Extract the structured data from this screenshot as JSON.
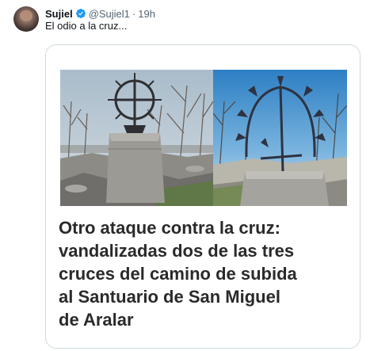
{
  "author": {
    "name": "Sujiel",
    "handle": "@Sujiel1",
    "separator": "·",
    "time": "19h",
    "verified": true
  },
  "tweet": {
    "text": "El odio a la cruz..."
  },
  "article": {
    "headline_lines": [
      "Otro ataque contra la cruz:",
      "vandalizadas dos de las tres",
      "cruces del camino de subida",
      "al Santuario de San Miguel",
      "de Aralar"
    ]
  },
  "colors": {
    "name": "#0f1419",
    "secondary": "#536471",
    "verified_badge": "#1d9bf0",
    "card_border": "#cfd9de",
    "headline": "#2a2a2a"
  },
  "icons": {
    "verified": "verified-badge-icon"
  }
}
